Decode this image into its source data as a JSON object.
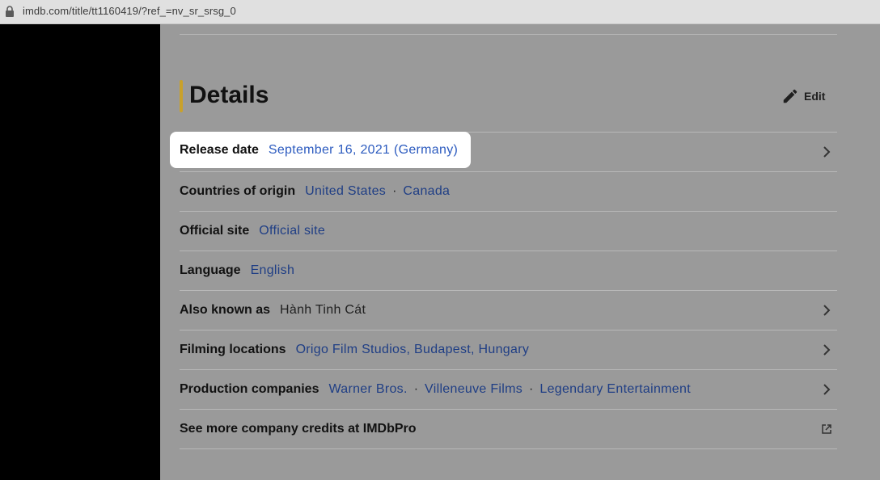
{
  "browser": {
    "url": "imdb.com/title/tt1160419/?ref_=nv_sr_srsg_0"
  },
  "details": {
    "title": "Details",
    "edit_label": "Edit",
    "release": {
      "label": "Release date",
      "value": "September 16, 2021 (Germany)"
    },
    "countries": {
      "label": "Countries of origin",
      "values": [
        "United States",
        "Canada"
      ]
    },
    "official": {
      "label": "Official site",
      "value": "Official site"
    },
    "language": {
      "label": "Language",
      "value": "English"
    },
    "aka": {
      "label": "Also known as",
      "value": "Hành Tinh Cát"
    },
    "filming": {
      "label": "Filming locations",
      "value": "Origo Film Studios, Budapest, Hungary"
    },
    "companies": {
      "label": "Production companies",
      "values": [
        "Warner Bros.",
        "Villeneuve Films",
        "Legendary Entertainment"
      ]
    },
    "imdbpro": {
      "label": "See more company credits at IMDbPro"
    },
    "separator": "·"
  },
  "colors": {
    "accent": "#c9a12a",
    "link": "#1f3e85",
    "highlight_link": "#2c5bbf"
  },
  "icons": [
    "lock-icon",
    "pencil-icon",
    "chevron-right-icon",
    "external-link-icon"
  ]
}
